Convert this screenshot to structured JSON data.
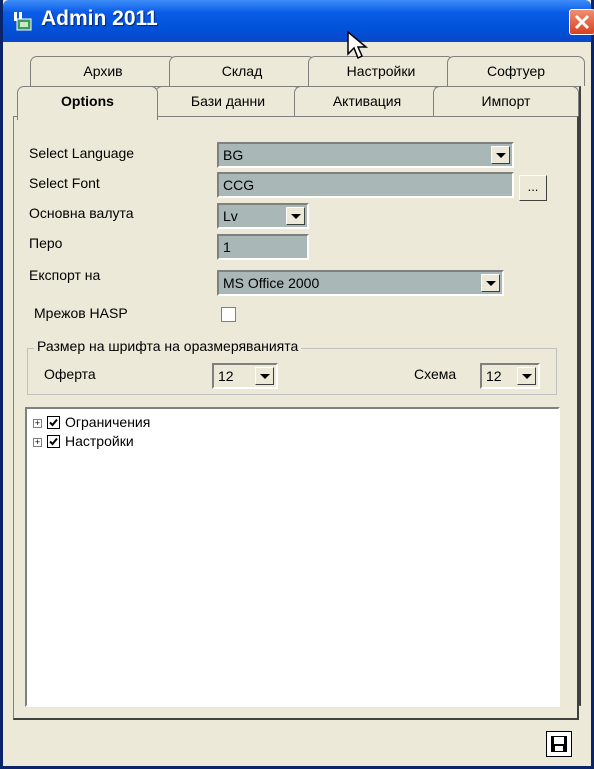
{
  "window": {
    "title": "Admin 2011",
    "title_color": "#0054e3",
    "close_color": "#d84020"
  },
  "tabs_back": [
    "Архив",
    "Склад",
    "Настройки",
    "Софтуер"
  ],
  "tabs_front": [
    "Options",
    "Бази данни",
    "Активация",
    "Импорт"
  ],
  "active_tab": "Options",
  "form": {
    "language_label": "Select Language",
    "language_value": "BG",
    "font_label": "Select Font",
    "font_value": "CCG",
    "font_button": "...",
    "currency_label": "Основна валута",
    "currency_value": "Lv",
    "pen_label": "Перо",
    "pen_value": "1",
    "export_label": "Експорт на",
    "export_value": "MS Office 2000",
    "hasp_label": "Мрежов HASP",
    "hasp_checked": false
  },
  "dimension_group": {
    "title": "Размер на шрифта на оразмеряванията",
    "offer_label": "Оферта",
    "offer_value": "12",
    "scheme_label": "Схема",
    "scheme_value": "12"
  },
  "tree": [
    {
      "label": "Ограничения",
      "checked": true
    },
    {
      "label": "Настройки",
      "checked": true
    }
  ],
  "icons": {
    "app": "app-window-icon",
    "close": "close-icon",
    "cursor": "mouse-cursor-icon",
    "save": "save-disk-icon"
  }
}
